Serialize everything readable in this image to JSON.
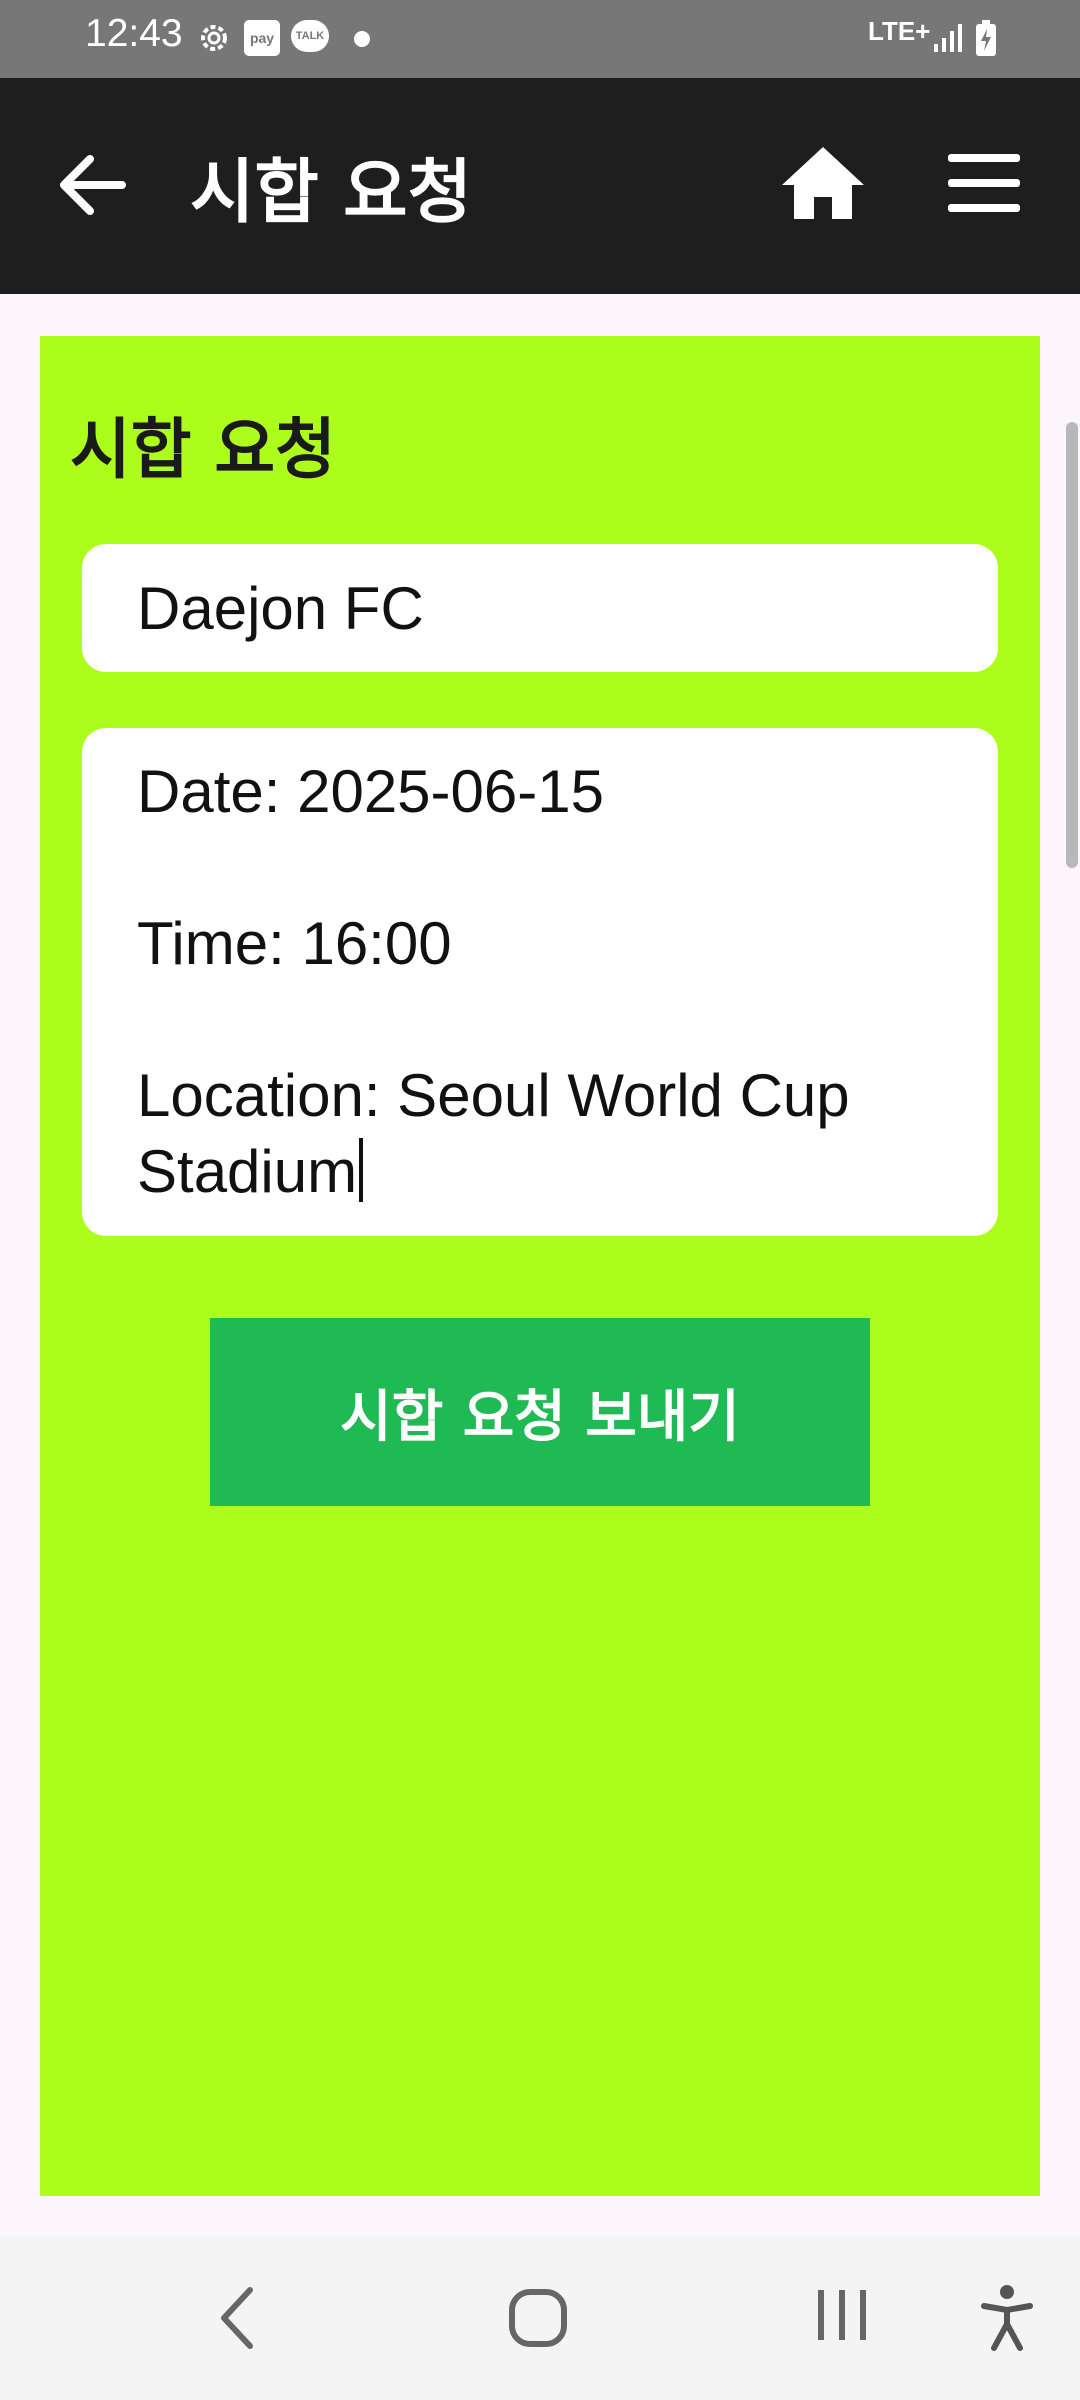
{
  "status_bar": {
    "time": "12:43",
    "network": "LTE+",
    "icons": [
      "settings-icon",
      "pay-icon",
      "talk-icon",
      "notification-dot",
      "signal-icon",
      "battery-icon"
    ],
    "pay_label": "pay",
    "talk_label": "TALK"
  },
  "app_bar": {
    "title": "시합 요청",
    "back_icon": "arrow-left-icon",
    "home_icon": "home-icon",
    "menu_icon": "hamburger-menu-icon"
  },
  "form": {
    "heading": "시합 요청",
    "team_value": "Daejon FC",
    "details": {
      "date": "Date: 2025-06-15",
      "time": "Time: 16:00",
      "location_line1": "Location: Seoul World Cup",
      "location_line2": "Stadium"
    },
    "submit_label": "시합 요청 보내기"
  },
  "nav_bar": {
    "icons": [
      "nav-back-icon",
      "nav-home-icon",
      "nav-recents-icon",
      "accessibility-icon"
    ]
  },
  "colors": {
    "status_bar": "#777777",
    "app_bar": "#1e1e1e",
    "card_background": "#adfd1c",
    "submit_button": "#1fba54",
    "page_background": "#fcf6fc"
  }
}
